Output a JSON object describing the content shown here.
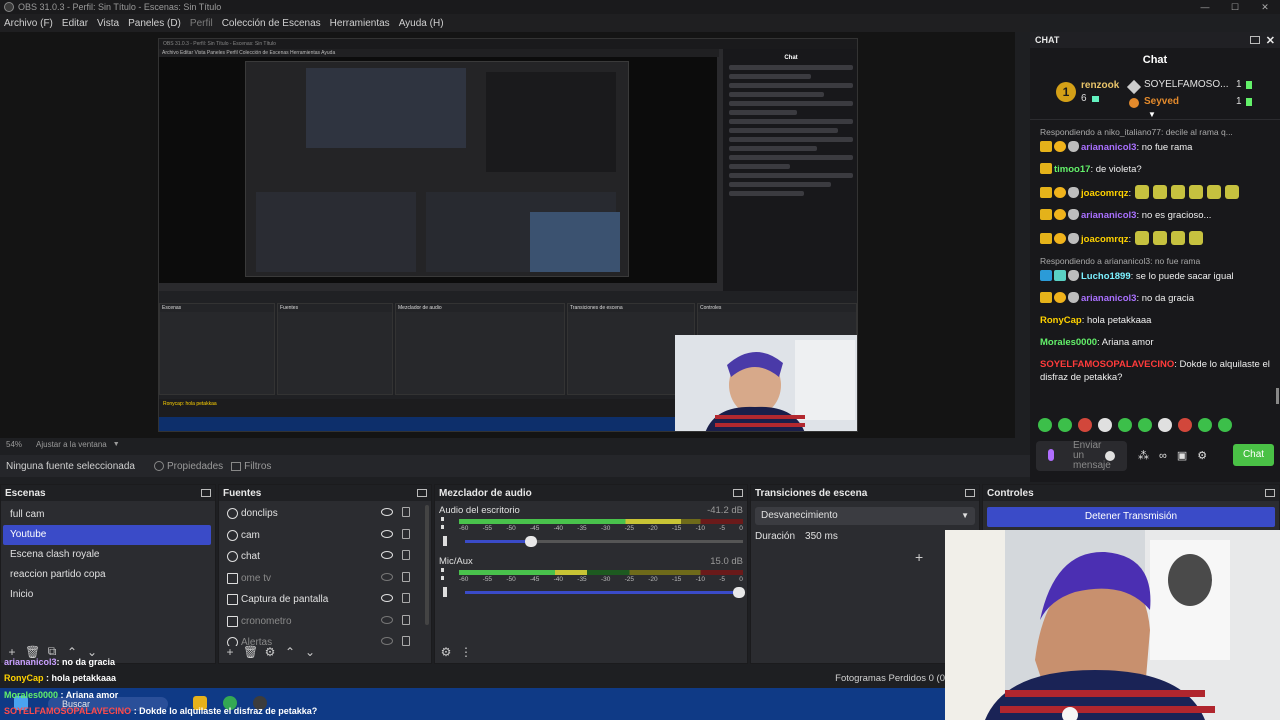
{
  "window": {
    "title": "OBS 31.0.3 - Perfil: Sin Título - Escenas: Sin Título",
    "controls": [
      "—",
      "☐",
      "✕"
    ]
  },
  "menu": [
    "Archivo (F)",
    "Editar",
    "Vista",
    "Paneles (D)",
    "Perfil",
    "Colección de Escenas",
    "Herramientas",
    "Ayuda (H)"
  ],
  "preview": {
    "zoom": "54%",
    "fit": "Ajustar a la ventana",
    "nested_title": "OBS 31.0.3 - Perfil: Sin Título - Escenas: Sin Título",
    "nested_menu": "Archivo  Editar  Vista  Paneles  Perfil  Colección de Escenas  Herramientas  Ayuda",
    "nested_chat_title": "Chat",
    "nested_overlay": "Ronycap: hola petakkaa"
  },
  "source_toolbar": {
    "no_source": "Ninguna fuente seleccionada",
    "properties": "Propiedades",
    "filters": "Filtros"
  },
  "scenes": {
    "title": "Escenas",
    "items": [
      "full cam",
      "Youtube",
      "Escena clash royale",
      "reaccion partido copa",
      "Inicio"
    ],
    "selected": 1,
    "tools": [
      "+",
      "🗑",
      "⧉",
      "⌃",
      "⌄"
    ]
  },
  "sources": {
    "title": "Fuentes",
    "items": [
      {
        "name": "donclips",
        "visible": true
      },
      {
        "name": "cam",
        "visible": true
      },
      {
        "name": "chat",
        "visible": true
      },
      {
        "name": "ome tv",
        "visible": false
      },
      {
        "name": "Captura de pantalla",
        "visible": true
      },
      {
        "name": "cronometro",
        "visible": false
      },
      {
        "name": "Alertas",
        "visible": false
      }
    ],
    "tools": [
      "+",
      "🗑",
      "⚙",
      "⌃",
      "⌄"
    ]
  },
  "mixer": {
    "title": "Mezclador de audio",
    "channels": [
      {
        "name": "Audio del escritorio",
        "db": "-41.2 dB",
        "level": 0.78,
        "volume": 0.25
      },
      {
        "name": "Mic/Aux",
        "db": "15.0 dB",
        "level": 0.45,
        "volume": 1.0
      }
    ],
    "ticks": [
      "-60",
      "-55",
      "-50",
      "-45",
      "-40",
      "-35",
      "-30",
      "-25",
      "-20",
      "-15",
      "-10",
      "-5",
      "0"
    ]
  },
  "transitions": {
    "title": "Transiciones de escena",
    "selected": "Desvanecimiento",
    "duration_label": "Duración",
    "duration": "350 ms"
  },
  "controls": {
    "title": "Controles",
    "stop_stream": "Detener Transmisión"
  },
  "status": {
    "frames": "Fotogramas Perdidos 0 (0"
  },
  "overlays": {
    "line1_user": "ariananicol3",
    "line1_text": ": no da gracia",
    "line2_user": "RonyCap",
    "line2_text": " : hola petakkaaa",
    "line3_user": "Morales0000",
    "line3_text": " : Ariana amor",
    "line4_user": "SOYELFAMOSOPALAVECINO",
    "line4_text": " : Dokde lo alquilaste el disfraz de petakka?",
    "search": "Buscar"
  },
  "chat": {
    "dock_title": "CHAT",
    "title": "Chat",
    "leader": {
      "first_name": "renzook",
      "first_count": "6",
      "second_name": "SOYELFAMOSO...",
      "second_count": "1",
      "third_name": "Seyved",
      "third_count": "1",
      "medal": "1"
    },
    "messages": [
      {
        "reply": "Respondiendo a niko_italiano77: decile al rama q...",
        "user": "ariananicol3",
        "text": ": no fue rama",
        "color": "violet",
        "badges": [
          "crown",
          "one",
          "mask"
        ]
      },
      {
        "reply": "",
        "user": "timoo17",
        "text": ": de violeta?",
        "color": "green",
        "badges": [
          "crown"
        ]
      },
      {
        "reply": "",
        "user": "joacomrqz",
        "text": ":",
        "color": "gold",
        "badges": [
          "crown",
          "one",
          "mask"
        ],
        "emotes": 6
      },
      {
        "reply": "",
        "user": "ariananicol3",
        "text": ": no es gracioso...",
        "color": "violet",
        "badges": [
          "crown",
          "one",
          "mask"
        ]
      },
      {
        "reply": "",
        "user": "joacomrqz",
        "text": ":",
        "color": "gold",
        "badges": [
          "crown",
          "one",
          "mask"
        ],
        "emotes": 4
      },
      {
        "reply": "Respondiendo a ariananicol3: no fue rama",
        "user": "Lucho1899",
        "text": ": se lo puede sacar igual",
        "color": "lgreen",
        "badges": [
          "prime",
          "gift",
          "mask"
        ]
      },
      {
        "reply": "",
        "user": "ariananicol3",
        "text": ": no da gracia",
        "color": "violet",
        "badges": [
          "crown",
          "one",
          "mask"
        ]
      },
      {
        "reply": "",
        "user": "RonyCap",
        "text": ": hola petakkaaa",
        "color": "gold",
        "badges": []
      },
      {
        "reply": "",
        "user": "Morales0000",
        "text": ": Ariana amor",
        "color": "green",
        "badges": []
      },
      {
        "reply": "",
        "user": "SOYELFAMOSOPALAVECINO",
        "text": ": Dokde lo alquilaste el disfraz de petakka?",
        "color": "red",
        "badges": []
      }
    ],
    "input_placeholder": "Enviar un mensaje",
    "send": "Chat"
  },
  "colors": {
    "accent": "#3a4bc8",
    "chat_green": "#4ac146",
    "panel": "#2b2c30"
  }
}
